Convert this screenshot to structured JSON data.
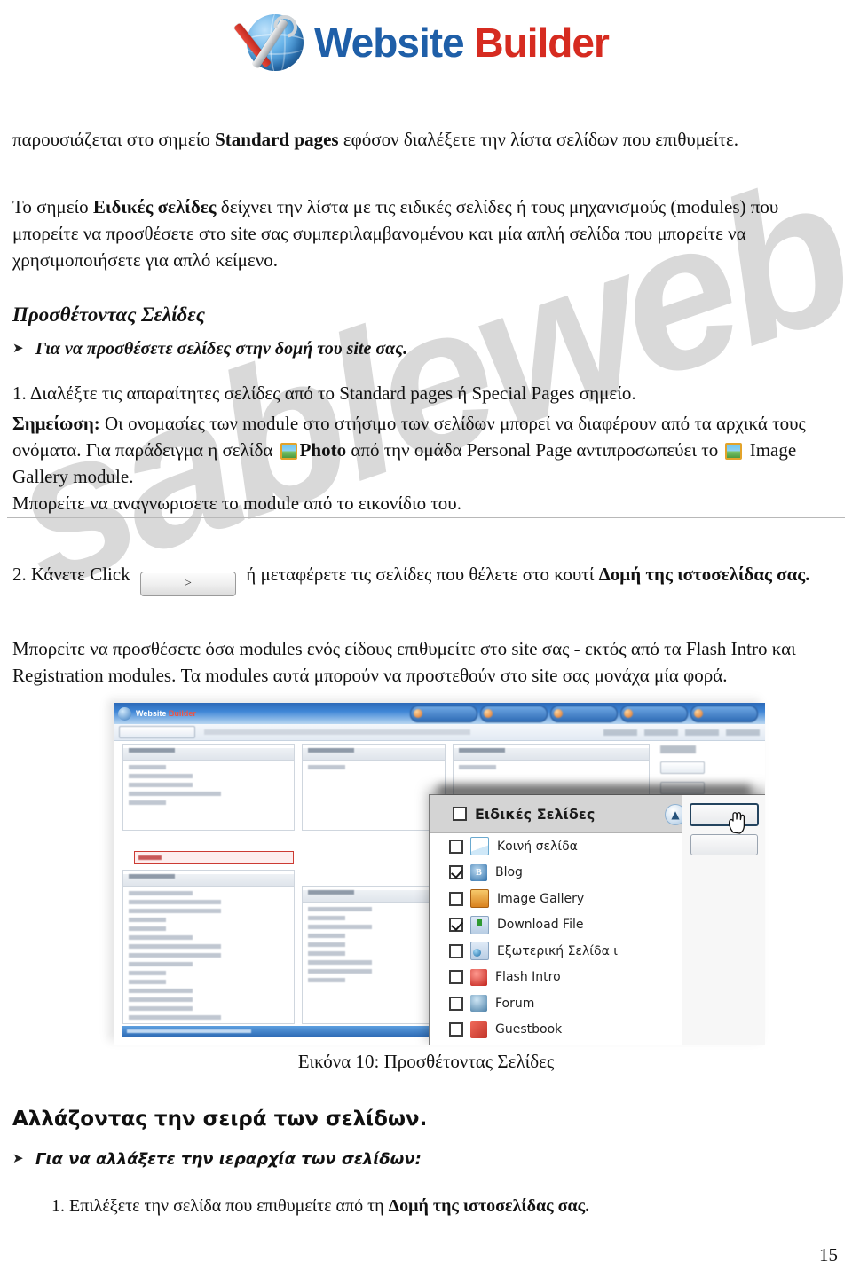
{
  "logo": {
    "icon": "globe-wrench-screwdriver-icon",
    "word_blue": "Website",
    "word_red": "Builder"
  },
  "document": {
    "intro_paragraph_before_bold": "παρουσιάζεται στο σημείο ",
    "intro_bold": "Standard pages",
    "intro_paragraph_after_bold": " εφόσον διαλέξετε την λίστα σελίδων που επιθυμείτε.",
    "special_before_bold": "Το σημείο ",
    "special_bold": "Ειδικές σελίδες",
    "special_after_bold": " δείχνει την λίστα με τις ειδικές σελίδες ή τους μηχανισμούς (modules) που μπορείτε να προσθέσετε στο site σας συμπεριλαμβανομένου και μία απλή σελίδα που μπορείτε να χρησιμοποιήσετε για απλό κείμενο.",
    "heading_adding_pages": "Προσθέτοντας Σελίδες",
    "bullet_add_pages": "Για να προσθέσετε σελίδες στην δομή του site σας.",
    "step1": "1. Διαλέξτε τις απαραίτητες σελίδες από το Standard pages ή Special Pages σημείο.",
    "note_label": "Σημείωση:",
    "note_text_1": "  Οι ονομασίες των module στο στήσιμο των σελίδων μπορεί να διαφέρουν από τα αρχικά τους ονόματα. Για παράδειγμα η σελίδα ",
    "note_bold_photo": "Photo",
    "note_text_2": " από την ομάδα Personal Page αντιπροσωπεύει το ",
    "note_text_3": " Image Gallery module.",
    "note_text_4": " Μπορείτε να αναγνωρισετε το module από το εικονίδιο του.",
    "step2_prefix": "2. Κάνετε Click ",
    "step2_button_label": ">",
    "step2_middle": " ή μεταφέρετε τις σελίδες που θέλετε στο κουτί ",
    "step2_bold": "Δομή της ιστοσελίδας σας.",
    "modules_paragraph": "Μπορείτε να προσθέσετε όσα modules ενός είδους επιθυμείτε στο site σας -  εκτός από τα Flash Intro και Registration modules. Τα modules αυτά μπορούν να προστεθούν στο site σας μονάχα μία φορά.",
    "figure_caption": "Εικόνα 10: Προσθέτοντας Σελίδες",
    "heading_reorder": "Αλλάζοντας την σειρά των σελίδων.",
    "bullet_hierarchy": "Για να αλλάξετε την ιεραρχία των σελίδων:",
    "ordered_step_1_prefix": "1.  Επιλέξετε την σελίδα που επιθυμείτε από τη ",
    "ordered_step_1_bold": "Δομή της ιστοσελίδας σας.",
    "page_number": "15",
    "watermark_text": "sableweb"
  },
  "screenshot": {
    "app_title_blue": "Website",
    "app_title_red": "Builder",
    "popup": {
      "header_label": "Ειδικές Σελίδες",
      "header_checked": false,
      "collapse_icon": "chevron-up-double-icon",
      "items": [
        {
          "label": "Κοινή σελίδα",
          "checked": false,
          "icon": "page-icon"
        },
        {
          "label": "Blog",
          "checked": true,
          "icon": "blog-icon"
        },
        {
          "label": "Image Gallery",
          "checked": false,
          "icon": "image-gallery-icon"
        },
        {
          "label": "Download File",
          "checked": true,
          "icon": "download-file-icon"
        },
        {
          "label": "Εξωτερική Σελίδα ι",
          "checked": false,
          "icon": "external-page-icon"
        },
        {
          "label": "Flash Intro",
          "checked": false,
          "icon": "flash-intro-icon"
        },
        {
          "label": "Forum",
          "checked": false,
          "icon": "forum-icon"
        },
        {
          "label": "Guestbook",
          "checked": false,
          "icon": "guestbook-icon"
        }
      ]
    }
  },
  "colors": {
    "logo_blue": "#1f5fa8",
    "logo_red": "#d62b20",
    "watermark_gray": "#d9d9d9",
    "popup_header_gray": "#d4d4d4",
    "accent_red_box": "#cc3b33"
  }
}
